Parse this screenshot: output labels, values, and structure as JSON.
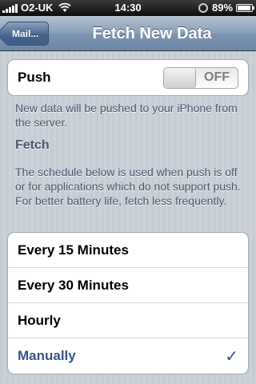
{
  "status_bar": {
    "carrier": "O2-UK",
    "time": "14:30",
    "battery_pct": "89%"
  },
  "nav": {
    "back_label": "Mail...",
    "title": "Fetch New Data"
  },
  "push": {
    "label": "Push",
    "toggle_state": "OFF",
    "description": "New data will be pushed to your iPhone from the server."
  },
  "fetch": {
    "header": "Fetch",
    "description": "The schedule below is used when push is off or for applications which do not support push. For better battery life, fetch less frequently.",
    "options": [
      {
        "label": "Every 15 Minutes",
        "selected": false
      },
      {
        "label": "Every 30 Minutes",
        "selected": false
      },
      {
        "label": "Hourly",
        "selected": false
      },
      {
        "label": "Manually",
        "selected": true
      }
    ],
    "checkmark": "✓"
  },
  "colors": {
    "selected_text": "#385487",
    "background": "#c5ccd4"
  }
}
